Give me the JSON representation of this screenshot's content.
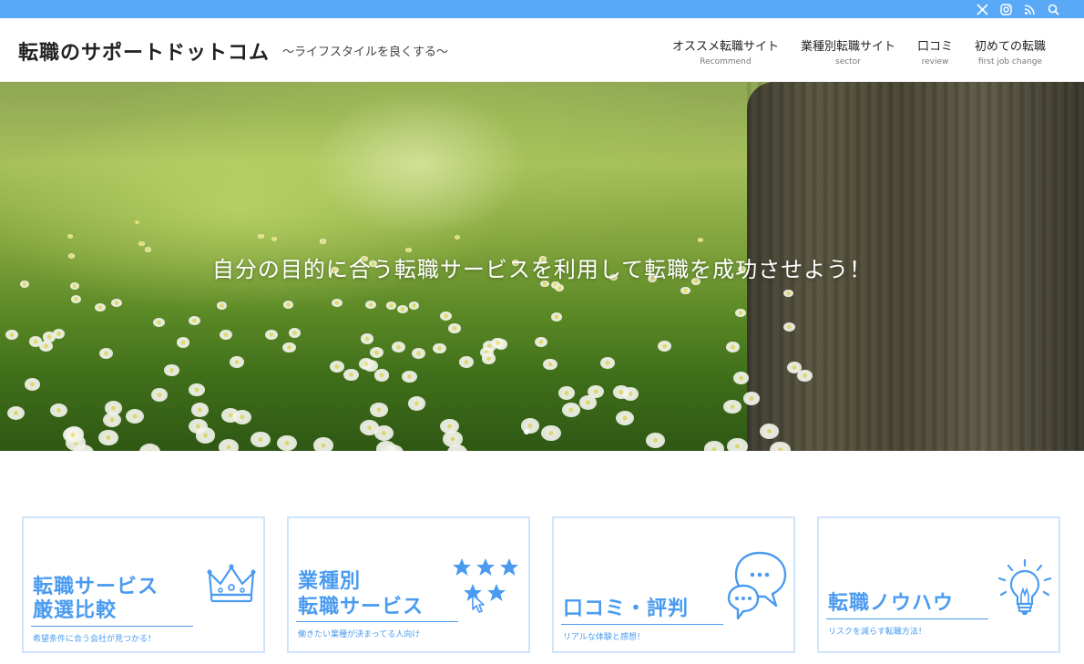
{
  "topbar": {
    "icons": [
      "x-icon",
      "instagram-icon",
      "rss-icon",
      "search-icon"
    ],
    "color": "#5aa9f7"
  },
  "header": {
    "title": "転職のサポートドットコム",
    "tagline": "〜ライフスタイルを良くする〜",
    "nav": [
      {
        "label": "オススメ転職サイト",
        "sub": "Recommend"
      },
      {
        "label": "業種別転職サイト",
        "sub": "sector"
      },
      {
        "label": "口コミ",
        "sub": "review"
      },
      {
        "label": "初めての転職",
        "sub": "first job change"
      }
    ]
  },
  "hero": {
    "text": "自分の目的に合う転職サービスを利用して転職を成功させよう！",
    "slide_count": 1
  },
  "cards": [
    {
      "title_line1": "転職サービス",
      "title_line2": "厳選比較",
      "caption": "希望条件に合う会社が見つかる！",
      "icon": "crown-icon"
    },
    {
      "title_line1": "業種別",
      "title_line2": "転職サービス",
      "caption": "働きたい業種が決まってる人向け",
      "icon": "stars-icon"
    },
    {
      "title_line1": "口コミ・評判",
      "title_line2": "",
      "caption": "リアルな体験と感想！",
      "icon": "speech-bubbles-icon"
    },
    {
      "title_line1": "転職ノウハウ",
      "title_line2": "",
      "caption": "リスクを減らす転職方法！",
      "icon": "lightbulb-icon"
    }
  ],
  "accent_color": "#4a9bf0"
}
